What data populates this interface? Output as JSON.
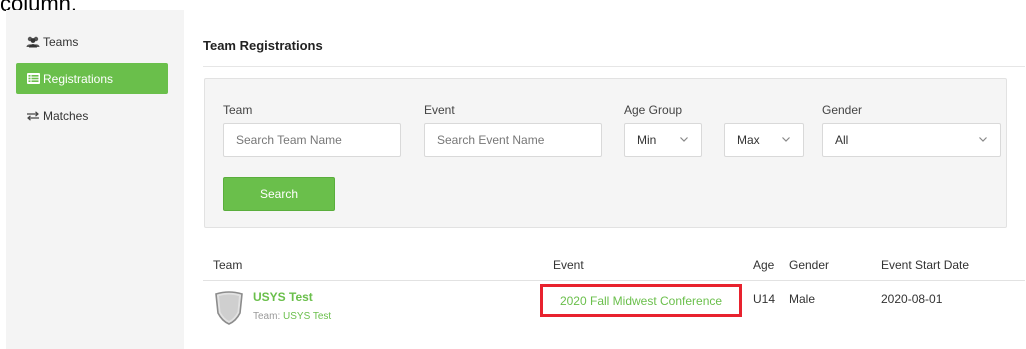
{
  "caption_fragment": "column.",
  "sidebar": {
    "items": [
      {
        "label": "Teams",
        "icon": "users-icon",
        "active": false
      },
      {
        "label": "Registrations",
        "icon": "list-icon",
        "active": true
      },
      {
        "label": "Matches",
        "icon": "swap-arrows-icon",
        "active": false
      }
    ]
  },
  "main": {
    "title": "Team Registrations",
    "filters": {
      "team": {
        "label": "Team",
        "placeholder": "Search Team Name"
      },
      "event": {
        "label": "Event",
        "placeholder": "Search Event Name"
      },
      "age_group": {
        "label": "Age Group",
        "min_value": "Min",
        "max_value": "Max"
      },
      "gender": {
        "label": "Gender",
        "value": "All"
      },
      "search_label": "Search"
    },
    "table": {
      "headers": [
        "Team",
        "Event",
        "Age",
        "Gender",
        "Event Start Date"
      ],
      "rows": [
        {
          "team_name": "USYS Test",
          "team_sub_label": "Team:",
          "team_sub_value": "USYS Test",
          "event": "2020 Fall Midwest Conference",
          "age": "U14",
          "gender": "Male",
          "start_date": "2020-08-01"
        }
      ]
    }
  },
  "colors": {
    "accent": "#6abf4b",
    "highlight_box": "#e8222e",
    "sidebar_bg": "#f4f4f4",
    "panel_bg": "#f5f5f5"
  }
}
